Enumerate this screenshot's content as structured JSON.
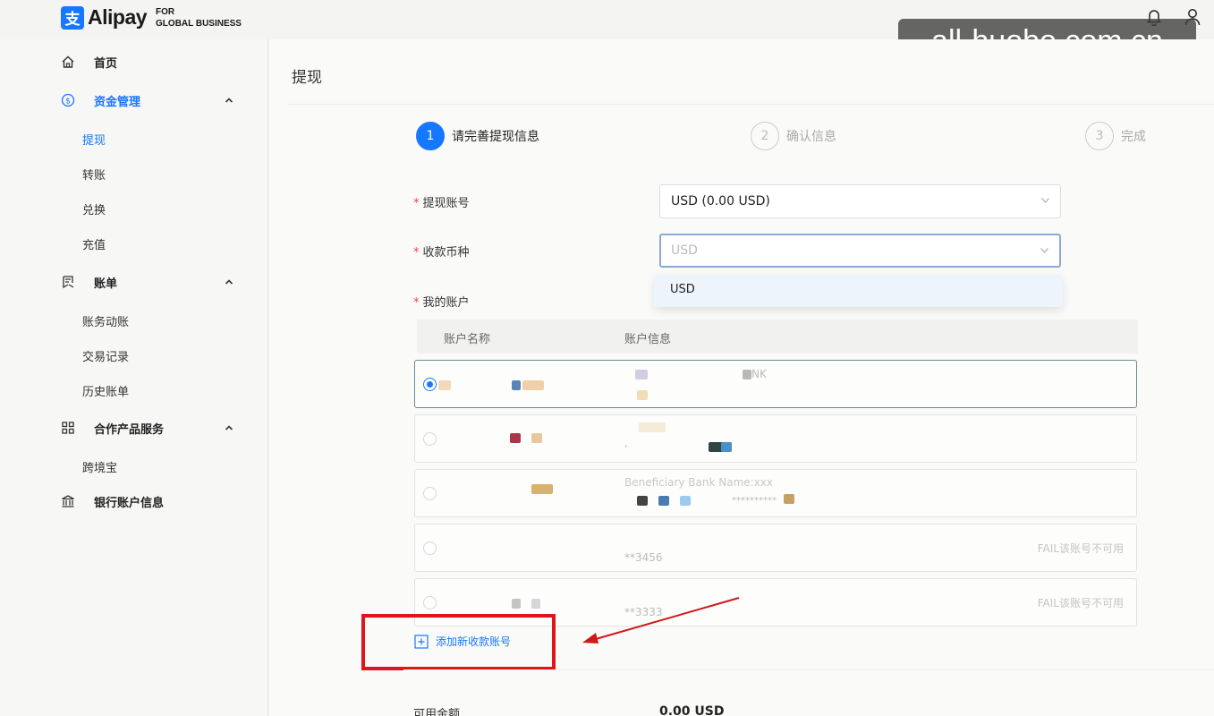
{
  "header": {
    "logo_glyph": "支",
    "brand": "Alipay",
    "brand_sub_line1": "FOR",
    "brand_sub_line2": "GLOBAL BUSINESS",
    "watermark": "all-huobo.com.cn",
    "accent_color": "#1677ff"
  },
  "sidebar": {
    "items": [
      {
        "label": "首页",
        "icon": "home-icon"
      },
      {
        "label": "资金管理",
        "icon": "dollar-circle-icon",
        "expanded": true,
        "children": [
          "提现",
          "转账",
          "兑换",
          "充值"
        ]
      },
      {
        "label": "账单",
        "icon": "bill-icon",
        "expanded": true,
        "children": [
          "账务动账",
          "交易记录",
          "历史账单"
        ]
      },
      {
        "label": "合作产品服务",
        "icon": "grid-icon",
        "expanded": true,
        "children": [
          "跨境宝"
        ]
      },
      {
        "label": "银行账户信息",
        "icon": "bank-icon"
      }
    ],
    "active_child": "提现"
  },
  "main": {
    "title": "提现",
    "steps": [
      {
        "num": "1",
        "label": "请完善提现信息"
      },
      {
        "num": "2",
        "label": "确认信息"
      },
      {
        "num": "3",
        "label": "完成"
      }
    ],
    "form": {
      "account_label": "提现账号",
      "account_value": "USD (0.00 USD)",
      "currency_label": "收款币种",
      "currency_placeholder": "USD",
      "currency_option": "USD",
      "my_accounts_label": "我的账户",
      "required_mark": "*"
    },
    "table": {
      "col_name": "账户名称",
      "col_info": "账户信息",
      "rows": [
        {
          "info_line1": "NK",
          "info_line2": "",
          "status": ""
        },
        {
          "info_line1": "",
          "info_line2": ",",
          "status": ""
        },
        {
          "info_line1": "Beneficiary Bank Name:xxx",
          "info_line2": "**********",
          "status": ""
        },
        {
          "info_line1": "",
          "info_line2": "**3456",
          "status": "FAIL该账号不可用"
        },
        {
          "info_line1": "",
          "info_line2": "**3333",
          "status": "FAIL该账号不可用"
        }
      ]
    },
    "add_account": "添加新收款账号",
    "balance_label": "可用金额",
    "balance_value": "0.00 USD"
  }
}
